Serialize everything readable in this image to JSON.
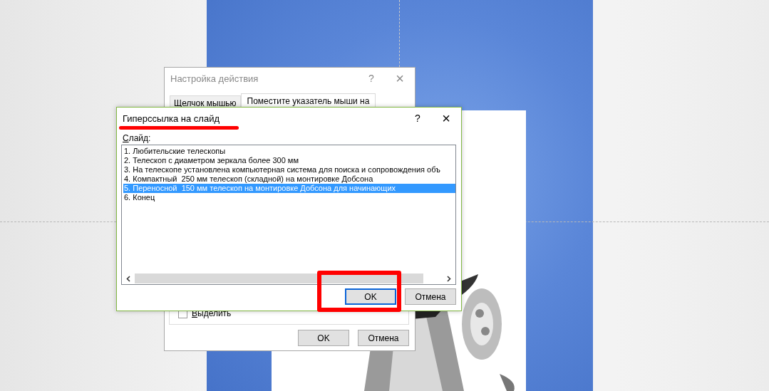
{
  "back_dialog": {
    "title": "Настройка действия",
    "help": "?",
    "close": "×",
    "tabs": [
      {
        "label": "Щелчок мышью",
        "selected": false
      },
      {
        "label": "Поместите указатель мыши на",
        "selected": true
      }
    ],
    "highlight_checkbox": {
      "label": "Выделить",
      "checked": false
    },
    "buttons": [
      "OK",
      "Отмена"
    ]
  },
  "front_dialog": {
    "title": "Гиперссылка на слайд",
    "help": "?",
    "close": "×",
    "list_label": "Слайд:",
    "slides": [
      {
        "label": "1. Любительские телескопы",
        "selected": false
      },
      {
        "label": "2. Телескоп с диаметром зеркала более 300 мм",
        "selected": false
      },
      {
        "label": "3. На телескопе установлена компьютерная система для поиска и сопровождения объ",
        "selected": false
      },
      {
        "label": "4. Компактный  250 мм телескоп (складной) на монтировке Добсона",
        "selected": false
      },
      {
        "label": "5. Переносной  150 мм телескоп на монтировке Добсона для начинающих",
        "selected": true
      },
      {
        "label": "6. Конец",
        "selected": false
      }
    ],
    "buttons": [
      {
        "label": "OK",
        "default": true
      },
      {
        "label": "Отмена",
        "default": false
      }
    ]
  },
  "annotations": [
    {
      "kind": "underline"
    },
    {
      "kind": "box"
    }
  ]
}
